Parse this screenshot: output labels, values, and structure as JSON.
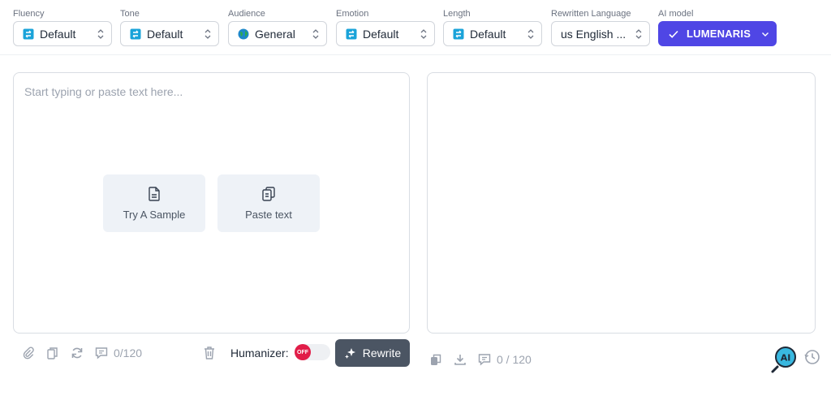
{
  "toolbar": {
    "fields": [
      {
        "label": "Fluency",
        "value": "Default",
        "icon": "default-icon"
      },
      {
        "label": "Tone",
        "value": "Default",
        "icon": "default-icon"
      },
      {
        "label": "Audience",
        "value": "General",
        "icon": "globe-icon"
      },
      {
        "label": "Emotion",
        "value": "Default",
        "icon": "default-icon"
      },
      {
        "label": "Length",
        "value": "Default",
        "icon": "default-icon"
      },
      {
        "label": "Rewritten Language",
        "value": "us English ...",
        "icon": ""
      },
      {
        "label": "AI model",
        "value": "LUMENARIS",
        "icon": "check-icon"
      }
    ]
  },
  "editor": {
    "placeholder": "Start typing or paste text here...",
    "sample_label": "Try A Sample",
    "paste_label": "Paste text",
    "counter": "0/120"
  },
  "controls": {
    "humanizer_label": "Humanizer:",
    "toggle_state": "OFF",
    "rewrite_label": "Rewrite"
  },
  "output": {
    "counter": "0 / 120"
  },
  "badge": {
    "ai_text": "AI"
  },
  "colors": {
    "accent": "#4f46e5",
    "rewrite_button": "#4b5563",
    "toggle_off": "#e11d48",
    "default_icon": "#1aa3d9",
    "ai_badge": "#39b8e0"
  }
}
